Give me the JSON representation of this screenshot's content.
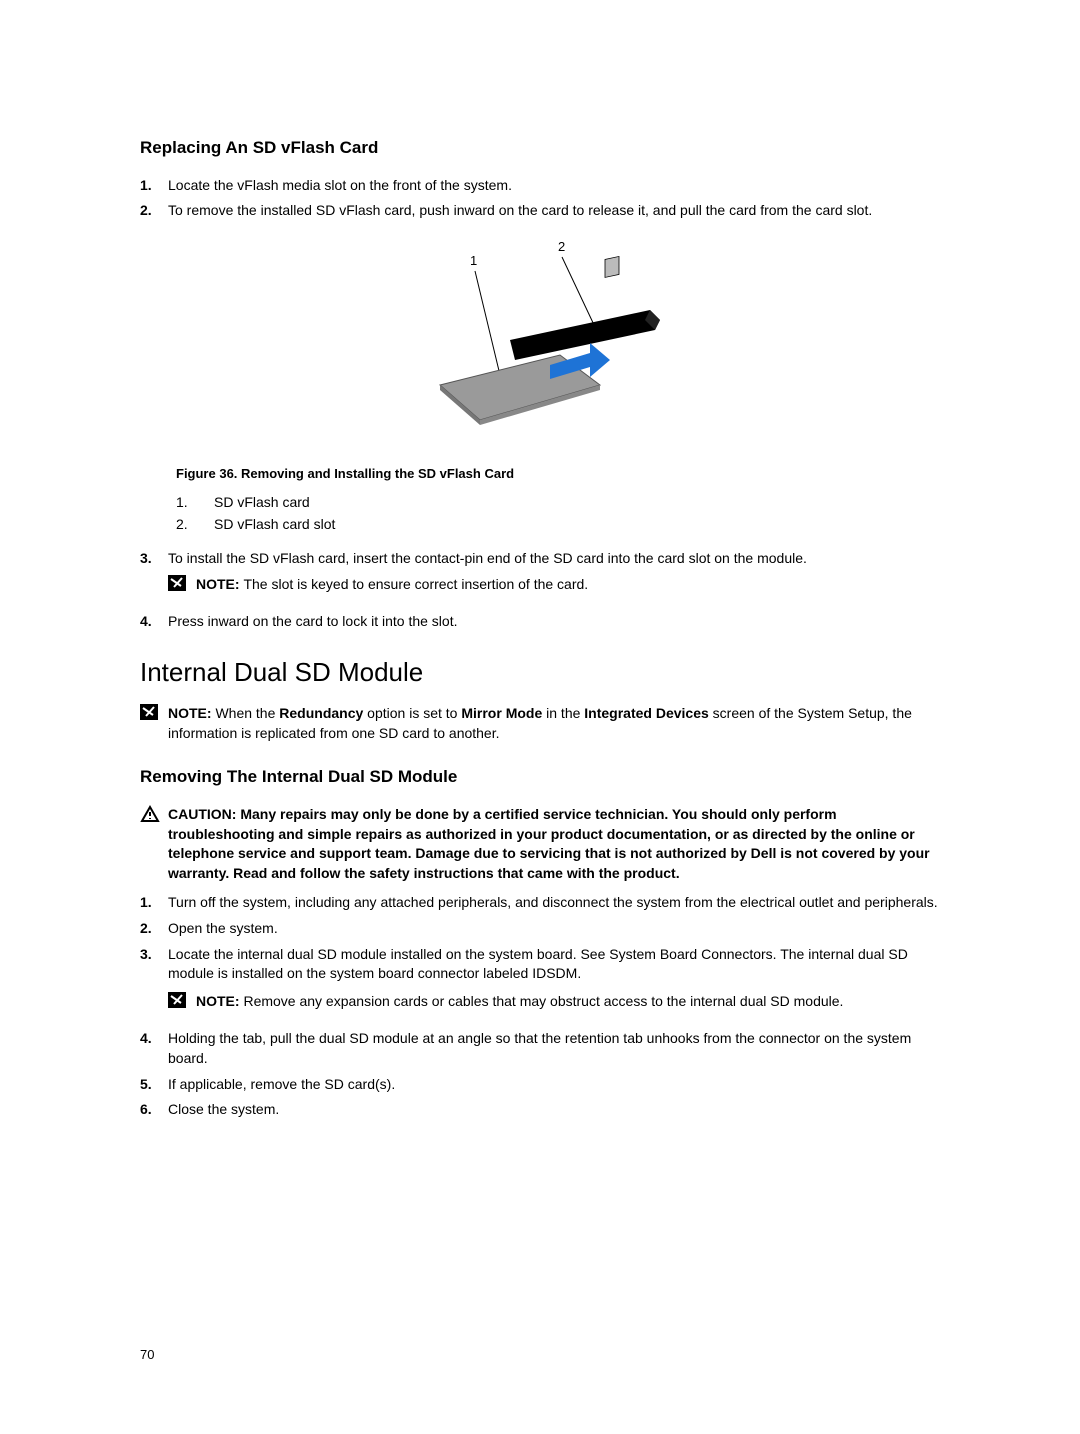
{
  "section1": {
    "heading": "Replacing An SD vFlash Card",
    "steps_a": [
      {
        "num": "1.",
        "text": "Locate the vFlash media slot on the front of the system."
      },
      {
        "num": "2.",
        "text": "To remove the installed SD vFlash card, push inward on the card to release it, and pull the card from the card slot."
      }
    ],
    "figure": {
      "label1": "1",
      "label2": "2",
      "caption": "Figure 36. Removing and Installing the SD vFlash Card",
      "callouts": [
        {
          "num": "1.",
          "text": "SD vFlash card"
        },
        {
          "num": "2.",
          "text": "SD vFlash card slot"
        }
      ]
    },
    "step3": {
      "num": "3.",
      "text": "To install the SD vFlash card, insert the contact-pin end of the SD card into the card slot on the module.",
      "note_label": "NOTE: ",
      "note_text": "The slot is keyed to ensure correct insertion of the card."
    },
    "step4": {
      "num": "4.",
      "text": "Press inward on the card to lock it into the slot."
    }
  },
  "section2": {
    "heading": "Internal Dual SD Module",
    "note_label": "NOTE: ",
    "note_pre": "When the ",
    "note_b1": "Redundancy",
    "note_mid1": " option is set to ",
    "note_b2": "Mirror Mode",
    "note_mid2": " in the ",
    "note_b3": "Integrated Devices",
    "note_post": " screen of the System Setup, the information is replicated from one SD card to another."
  },
  "section3": {
    "heading": "Removing The Internal Dual SD Module",
    "caution_label": "CAUTION: ",
    "caution_text": "Many repairs may only be done by a certified service technician. You should only perform troubleshooting and simple repairs as authorized in your product documentation, or as directed by the online or telephone service and support team. Damage due to servicing that is not authorized by Dell is not covered by your warranty. Read and follow the safety instructions that came with the product.",
    "steps": [
      {
        "num": "1.",
        "text": "Turn off the system, including any attached peripherals, and disconnect the system from the electrical outlet and peripherals."
      },
      {
        "num": "2.",
        "text": "Open the system."
      },
      {
        "num": "3.",
        "text": "Locate the internal dual SD module installed on the system board. See System Board Connectors. The internal dual SD module is installed on the system board connector labeled IDSDM."
      }
    ],
    "note_label": "NOTE: ",
    "note_text": "Remove any expansion cards or cables that may obstruct access to the internal dual SD module.",
    "steps_b": [
      {
        "num": "4.",
        "text": "Holding the tab, pull the dual SD module at an angle so that the retention tab unhooks from the connector on the system board."
      },
      {
        "num": "5.",
        "text": "If applicable, remove the SD card(s)."
      },
      {
        "num": "6.",
        "text": "Close the system."
      }
    ]
  },
  "page_number": "70"
}
